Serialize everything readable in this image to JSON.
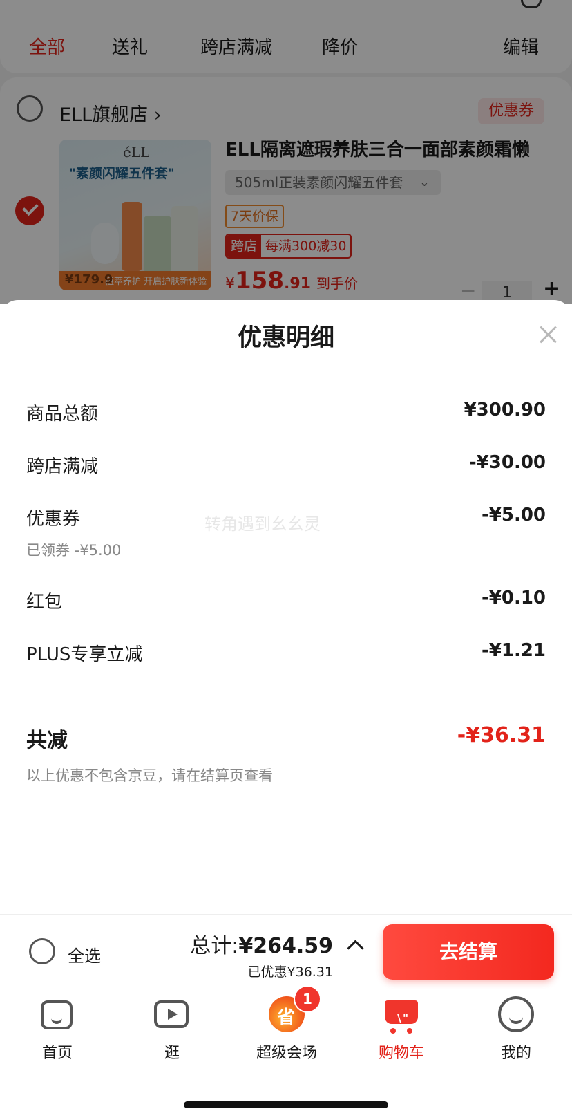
{
  "filter_tabs": [
    "全部",
    "送礼",
    "跨店满减",
    "降价"
  ],
  "filter_edit": "编辑",
  "store": {
    "name": "ELL旗舰店",
    "chevron": "›",
    "coupon_tag": "优惠券"
  },
  "product": {
    "thumb_brand": "éLL",
    "thumb_slogan": "\"素颜闪耀五件套\"",
    "thumb_strip": "植萃养护 开启护肤新体验",
    "thumb_price": "¥179.9",
    "title": "ELL隔离遮瑕养肤三合一面部素颜霜懒",
    "spec": "505ml正装素颜闪耀五件套",
    "spec_chevron": "⌄",
    "tag_guarantee": "7天价保",
    "tag_cross_left": "跨店",
    "tag_cross_right": "每满300减30",
    "price_symbol": "¥",
    "price_int": "158",
    "price_dec": ".91",
    "price_hint": "到手价",
    "quantity": "1",
    "minus": "−",
    "plus": "+"
  },
  "sheet": {
    "title": "优惠明细",
    "close_icon": "close-icon",
    "rows": [
      {
        "label": "商品总额",
        "value": "¥300.90"
      },
      {
        "label": "跨店满减",
        "value": "-¥30.00"
      },
      {
        "label": "优惠券",
        "value": "-¥5.00",
        "sub": "已领券 -¥5.00"
      },
      {
        "label": "红包",
        "value": "-¥0.10"
      },
      {
        "label": "PLUS专享立减",
        "value": "-¥1.21"
      }
    ],
    "total_label": "共减",
    "total_value": "-¥36.31",
    "footnote": "以上优惠不包含京豆，请在结算页查看",
    "watermark": "转角遇到幺幺灵"
  },
  "checkout": {
    "select_all": "全选",
    "total_prefix": "总计:",
    "total_amount": "¥264.59",
    "saved": "已优惠¥36.31",
    "pay_button": "去结算"
  },
  "tabbar": [
    {
      "label": "首页",
      "icon": "home-icon"
    },
    {
      "label": "逛",
      "icon": "video-icon"
    },
    {
      "label": "超级会场",
      "icon": "promo-icon",
      "badge": "1"
    },
    {
      "label": "购物车",
      "icon": "cart-icon"
    },
    {
      "label": "我的",
      "icon": "profile-icon"
    }
  ],
  "colors": {
    "accent": "#e2231a",
    "text": "#1a1a1a",
    "muted": "#888888"
  }
}
